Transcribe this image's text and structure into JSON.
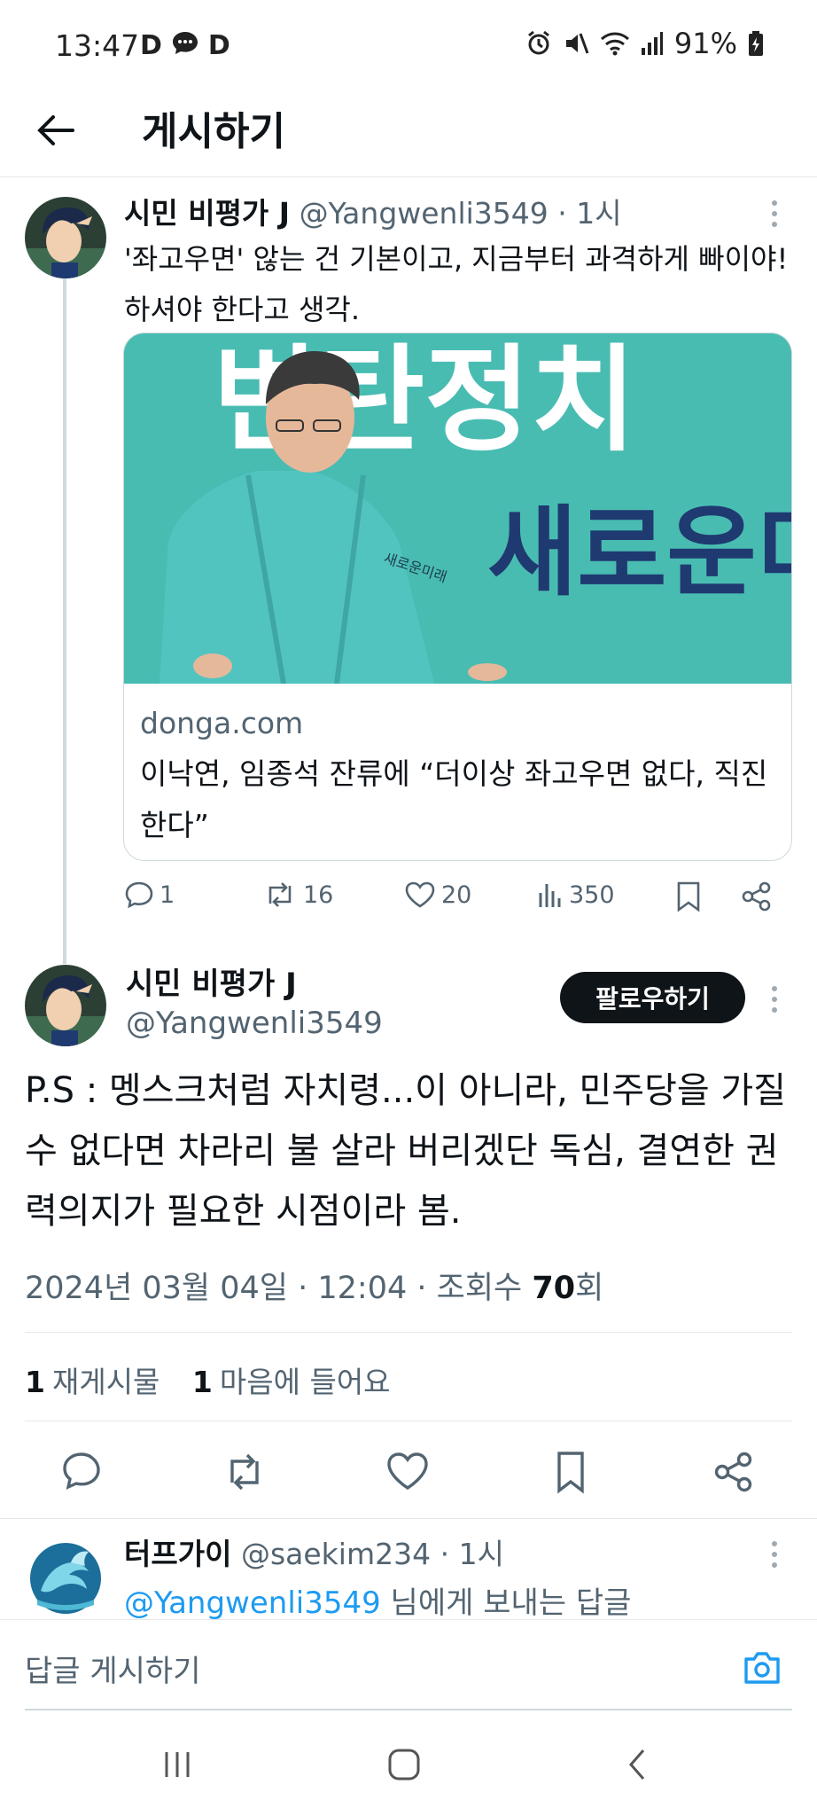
{
  "status_bar": {
    "time": "13:47",
    "notif_icons": [
      "D",
      "D"
    ],
    "battery": "91%"
  },
  "header": {
    "title": "게시하기"
  },
  "parent_tweet": {
    "name": "시민 비평가 J",
    "handle": "@Yangwenli3549",
    "time": "· 1시",
    "text": "'좌고우면' 않는 건 기본이고, 지금부터 과격하게 빠이야! 하셔야 한다고 생각.",
    "card": {
      "domain": "donga.com",
      "headline": "이낙연, 임종석 잔류에 “더이상 좌고우면 없다, 직진한다”",
      "image_text_top": "변탄정치",
      "image_text_bottom": "새로운미",
      "jacket_text": "새로운미래"
    },
    "actions": {
      "replies": "1",
      "retweets": "16",
      "likes": "20",
      "views": "350"
    }
  },
  "main_tweet": {
    "name": "시민 비평가 J",
    "handle": "@Yangwenli3549",
    "follow_label": "팔로우하기",
    "text": "P.S : 멩스크처럼 자치령...이 아니라, 민주당을 가질 수 없다면 차라리 불 살라 버리겠단 독심, 결연한 권력의지가 필요한 시점이라 봄.",
    "meta_prefix": "2024년 03월 04일 · 12:04 · 조회수 ",
    "views": "70",
    "views_suffix": "회",
    "retweet_count": "1",
    "retweet_label": "재게시물",
    "like_count": "1",
    "like_label": "마음에 들어요"
  },
  "reply": {
    "name": "터프가이",
    "handle": "@saekim234",
    "time": "· 1시",
    "mention": "@Yangwenli3549",
    "text": " 님에게 보내는 답글"
  },
  "composer": {
    "placeholder": "답글 게시하기"
  },
  "colors": {
    "accent": "#1d9bf0",
    "text": "#0f1419",
    "secondary": "#536471",
    "card_bg": "#3fb7ad"
  }
}
